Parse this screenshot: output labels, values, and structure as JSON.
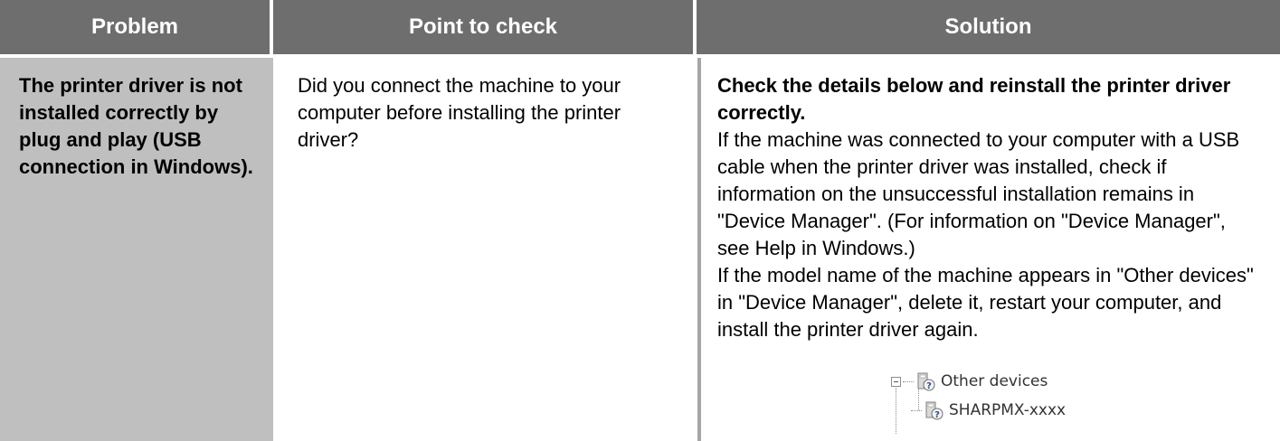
{
  "header": {
    "problem": "Problem",
    "point": "Point to check",
    "solution": "Solution"
  },
  "row": {
    "problem": "The printer driver is not installed correctly by plug and play (USB connection in Windows).",
    "point": "Did you connect the machine to your computer before installing the printer driver?",
    "solution_heading": "Check the details below and reinstall the printer driver correctly.",
    "solution_p1": "If the machine was connected to your computer with a USB cable when the printer driver was installed, check if information on the unsuccessful installation remains in \"Device Manager\". (For information on \"Device Manager\", see Help in Windows.)",
    "solution_p2": "If the model name of the machine appears in \"Other devices\" in \"Device Manager\", delete it, restart your computer, and install the printer driver again."
  },
  "tree": {
    "parent_label": "Other devices",
    "child_label": "SHARPMX-xxxx",
    "icon": "unknown-device-icon"
  },
  "colors": {
    "header_bg": "#6e6e6e",
    "problem_bg": "#bfbfbf",
    "divider": "#a6a6a6"
  }
}
